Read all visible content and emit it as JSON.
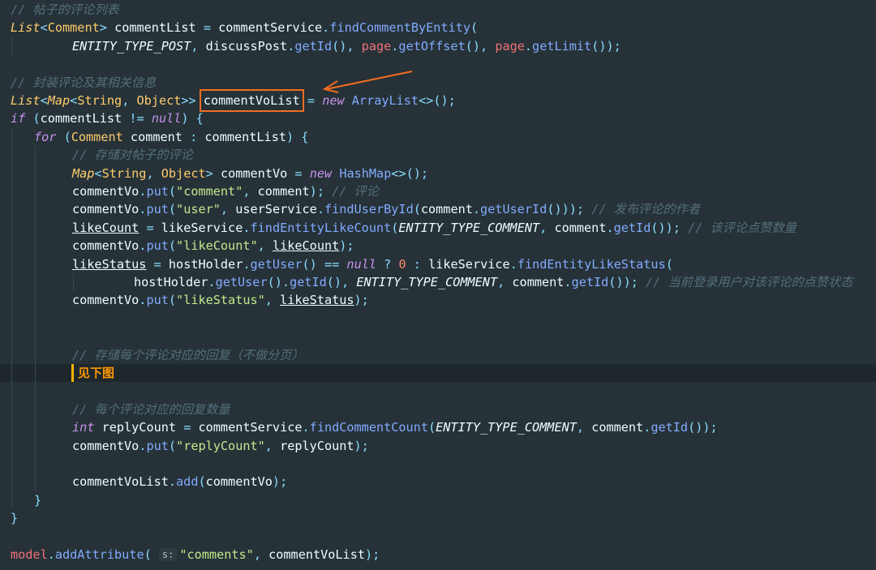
{
  "editor": {
    "note_label": "见下图",
    "param_hint": "s:"
  },
  "tokens": {
    "c_post_comments": "// 帖子的评论列表",
    "c_wrap_info": "// 封装评论及其相关信息",
    "c_store_post_comment": "// 存储对帖子的评论",
    "c_comment": "// 评论",
    "c_author": "// 发布评论的作者",
    "c_like_count": "// 该评论点赞数量",
    "c_like_status": "// 当前登录用户对该评论的点赞状态",
    "c_replies": "// 存储每个评论对应的回复（不做分页）",
    "c_reply_count": "// 每个评论对应的回复数量",
    "s_comment": "\"comment\"",
    "s_user": "\"user\"",
    "s_likeCount": "\"likeCount\"",
    "s_likeStatus": "\"likeStatus\"",
    "s_replyCount": "\"replyCount\"",
    "s_comments": "\"comments\"",
    "n_zero": "0",
    "List": "List",
    "Map": "Map",
    "String": "String",
    "Object": "Object",
    "Comment": "Comment",
    "ArrayList": "ArrayList",
    "HashMap": "HashMap",
    "kw_if": "if",
    "kw_for": "for",
    "kw_new": "new",
    "kw_null": "null",
    "kw_int": "int",
    "commentList": "commentList",
    "commentService": "commentService",
    "findCommentByEntity": "findCommentByEntity",
    "ENTITY_TYPE_POST": "ENTITY_TYPE_POST",
    "ENTITY_TYPE_COMMENT": "ENTITY_TYPE_COMMENT",
    "discussPost": "discussPost",
    "getId": "getId",
    "page": "page",
    "getOffset": "getOffset",
    "getLimit": "getLimit",
    "commentVoList": "commentVoList",
    "comment": "comment",
    "commentVo": "commentVo",
    "put": "put",
    "userService": "userService",
    "findUserById": "findUserById",
    "getUserId": "getUserId",
    "likeCount": "likeCount",
    "likeService": "likeService",
    "findEntityLikeCount": "findEntityLikeCount",
    "likeStatus": "likeStatus",
    "hostHolder": "hostHolder",
    "getUser": "getUser",
    "findEntityLikeStatus": "findEntityLikeStatus",
    "replyCount": "replyCount",
    "findCommentCount": "findCommentCount",
    "add": "add",
    "model": "model",
    "addAttribute": "addAttribute"
  },
  "colors": {
    "background": "#263238",
    "keyword": "#c792ea",
    "type": "#ffcb6b",
    "method": "#82aaff",
    "string": "#c3e88d",
    "comment": "#546e7a",
    "punctuation": "#89ddff",
    "property": "#f07178",
    "number": "#f78c6c",
    "highlight_box": "#f26d21",
    "note": "#ff9800"
  }
}
